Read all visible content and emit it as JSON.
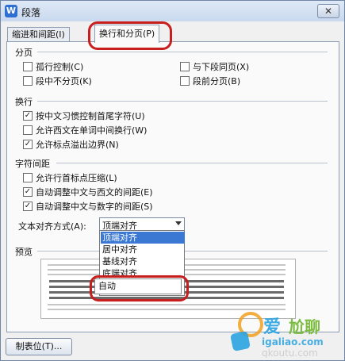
{
  "window": {
    "title": "段落",
    "app_icon_letter": "W",
    "close_symbol": "✕"
  },
  "tabs": [
    {
      "label": "缩进和间距(I)"
    },
    {
      "label": "换行和分页(P)"
    }
  ],
  "pagination": {
    "heading": "分页",
    "items": [
      {
        "label": "孤行控制(C)",
        "checked": false
      },
      {
        "label": "与下段同页(X)",
        "checked": false
      },
      {
        "label": "段中不分页(K)",
        "checked": false
      },
      {
        "label": "段前分页(B)",
        "checked": false
      }
    ]
  },
  "line_break": {
    "heading": "换行",
    "items": [
      {
        "label": "按中文习惯控制首尾字符(U)",
        "checked": true
      },
      {
        "label": "允许西文在单词中间换行(W)",
        "checked": false
      },
      {
        "label": "允许标点溢出边界(N)",
        "checked": true
      }
    ]
  },
  "char_spacing": {
    "heading": "字符间距",
    "items": [
      {
        "label": "允许行首标点压缩(L)",
        "checked": false
      },
      {
        "label": "自动调整中文与西文的间距(E)",
        "checked": true
      },
      {
        "label": "自动调整中文与数字的间距(S)",
        "checked": true
      }
    ]
  },
  "alignment": {
    "label": "文本对齐方式(A):",
    "selected": "顶端对齐",
    "options": [
      "顶端对齐",
      "居中对齐",
      "基线对齐",
      "底端对齐",
      "自动"
    ]
  },
  "preview": {
    "heading": "预览"
  },
  "buttons": {
    "tab_stops": "制表位(T)..."
  },
  "watermark": {
    "text1": "爱",
    "text2": "尬聊",
    "url": "igaliao.com",
    "site": "qkoutu.com"
  },
  "colors": {
    "accent": "#3a78d4",
    "highlight": "#c81e1e",
    "panel": "#fafafa"
  }
}
